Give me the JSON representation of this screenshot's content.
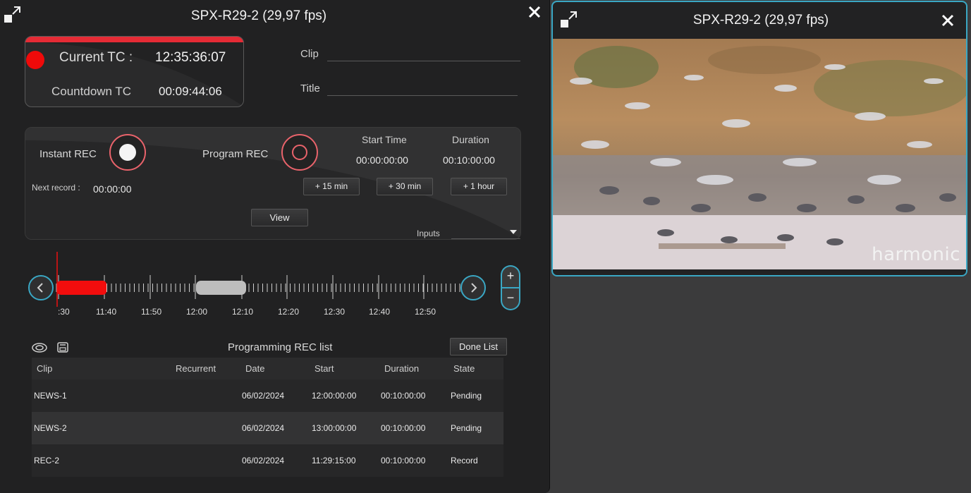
{
  "left_panel": {
    "title": "SPX-R29-2 (29,97 fps)",
    "timecode": {
      "current_label": "Current TC :",
      "current_value": "12:35:36:07",
      "countdown_label": "Countdown TC",
      "countdown_value": "00:09:44:06"
    },
    "clip_label": "Clip",
    "title_label": "Title",
    "rec": {
      "instant_label": "Instant REC",
      "program_label": "Program REC",
      "start_time_label": "Start Time",
      "start_time_value": "00:00:00:00",
      "duration_label": "Duration",
      "duration_value": "00:10:00:00",
      "next_record_label": "Next record :",
      "next_record_value": "00:00:00",
      "buttons": [
        "+ 15 min",
        "+ 30 min",
        "+ 1 hour"
      ],
      "view_label": "View",
      "inputs_label": "Inputs"
    },
    "timeline": {
      "ticks": [
        ":30",
        "11:40",
        "11:50",
        "12:00",
        "12:10",
        "12:20",
        "12:30",
        "12:40",
        "12:50"
      ],
      "zoom_in": "+",
      "zoom_out": "−"
    },
    "list": {
      "title": "Programming REC list",
      "done_label": "Done List",
      "columns": [
        "Clip",
        "Recurrent",
        "Date",
        "Start",
        "Duration",
        "State"
      ],
      "rows": [
        {
          "clip": "NEWS-1",
          "recurrent": "",
          "date": "06/02/2024",
          "start": "12:00:00:00",
          "duration": "00:10:00:00",
          "state": "Pending"
        },
        {
          "clip": "NEWS-2",
          "recurrent": "",
          "date": "06/02/2024",
          "start": "13:00:00:00",
          "duration": "00:10:00:00",
          "state": "Pending"
        },
        {
          "clip": "REC-2",
          "recurrent": "",
          "date": "06/02/2024",
          "start": "11:29:15:00",
          "duration": "00:10:00:00",
          "state": "Record"
        }
      ]
    }
  },
  "right_panel": {
    "title": "SPX-R29-2 (29,97 fps)",
    "logo": "harmonic"
  },
  "colors": {
    "accent": "#3aa7c4",
    "record": "#ef0a0a",
    "rec_ring": "#e9636b"
  },
  "icons": {
    "expand": "expand-icon",
    "close": "close-icon",
    "prev": "chevron-left-icon",
    "next": "chevron-right-icon",
    "eye": "eye-icon",
    "save": "save-icon"
  }
}
